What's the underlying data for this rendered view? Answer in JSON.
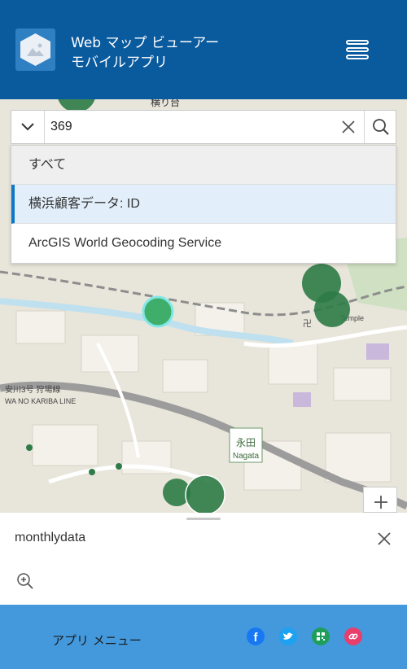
{
  "header": {
    "title_line1": "Web マップ ビューアー",
    "title_line2": "モバイルアプリ"
  },
  "search": {
    "value": "369",
    "suggestions": [
      {
        "label": "すべて",
        "type": "header"
      },
      {
        "label": "横浜顧客データ: ID",
        "type": "active"
      },
      {
        "label": "ArcGIS World Geocoding Service",
        "type": "normal"
      }
    ]
  },
  "map": {
    "labels": {
      "station_kanji": "永田",
      "station_roman": "Nagata",
      "temple": "Temple",
      "rail_line_jp": "安川3号 狩場線",
      "rail_line_en": "WA NO KARIBA LINE",
      "top_partial": "横り台"
    },
    "colors": {
      "point_fill": "#2e7b46",
      "selected_point": "#7fe8e6",
      "header_bg": "#0a5a9e",
      "footer_bg": "#4499dd"
    }
  },
  "popup": {
    "title": "monthlydata"
  },
  "footer": {
    "app_menu_label": "アプリ メニュー",
    "social": [
      "facebook-icon",
      "twitter-icon",
      "qrcode-icon",
      "link-icon"
    ]
  }
}
